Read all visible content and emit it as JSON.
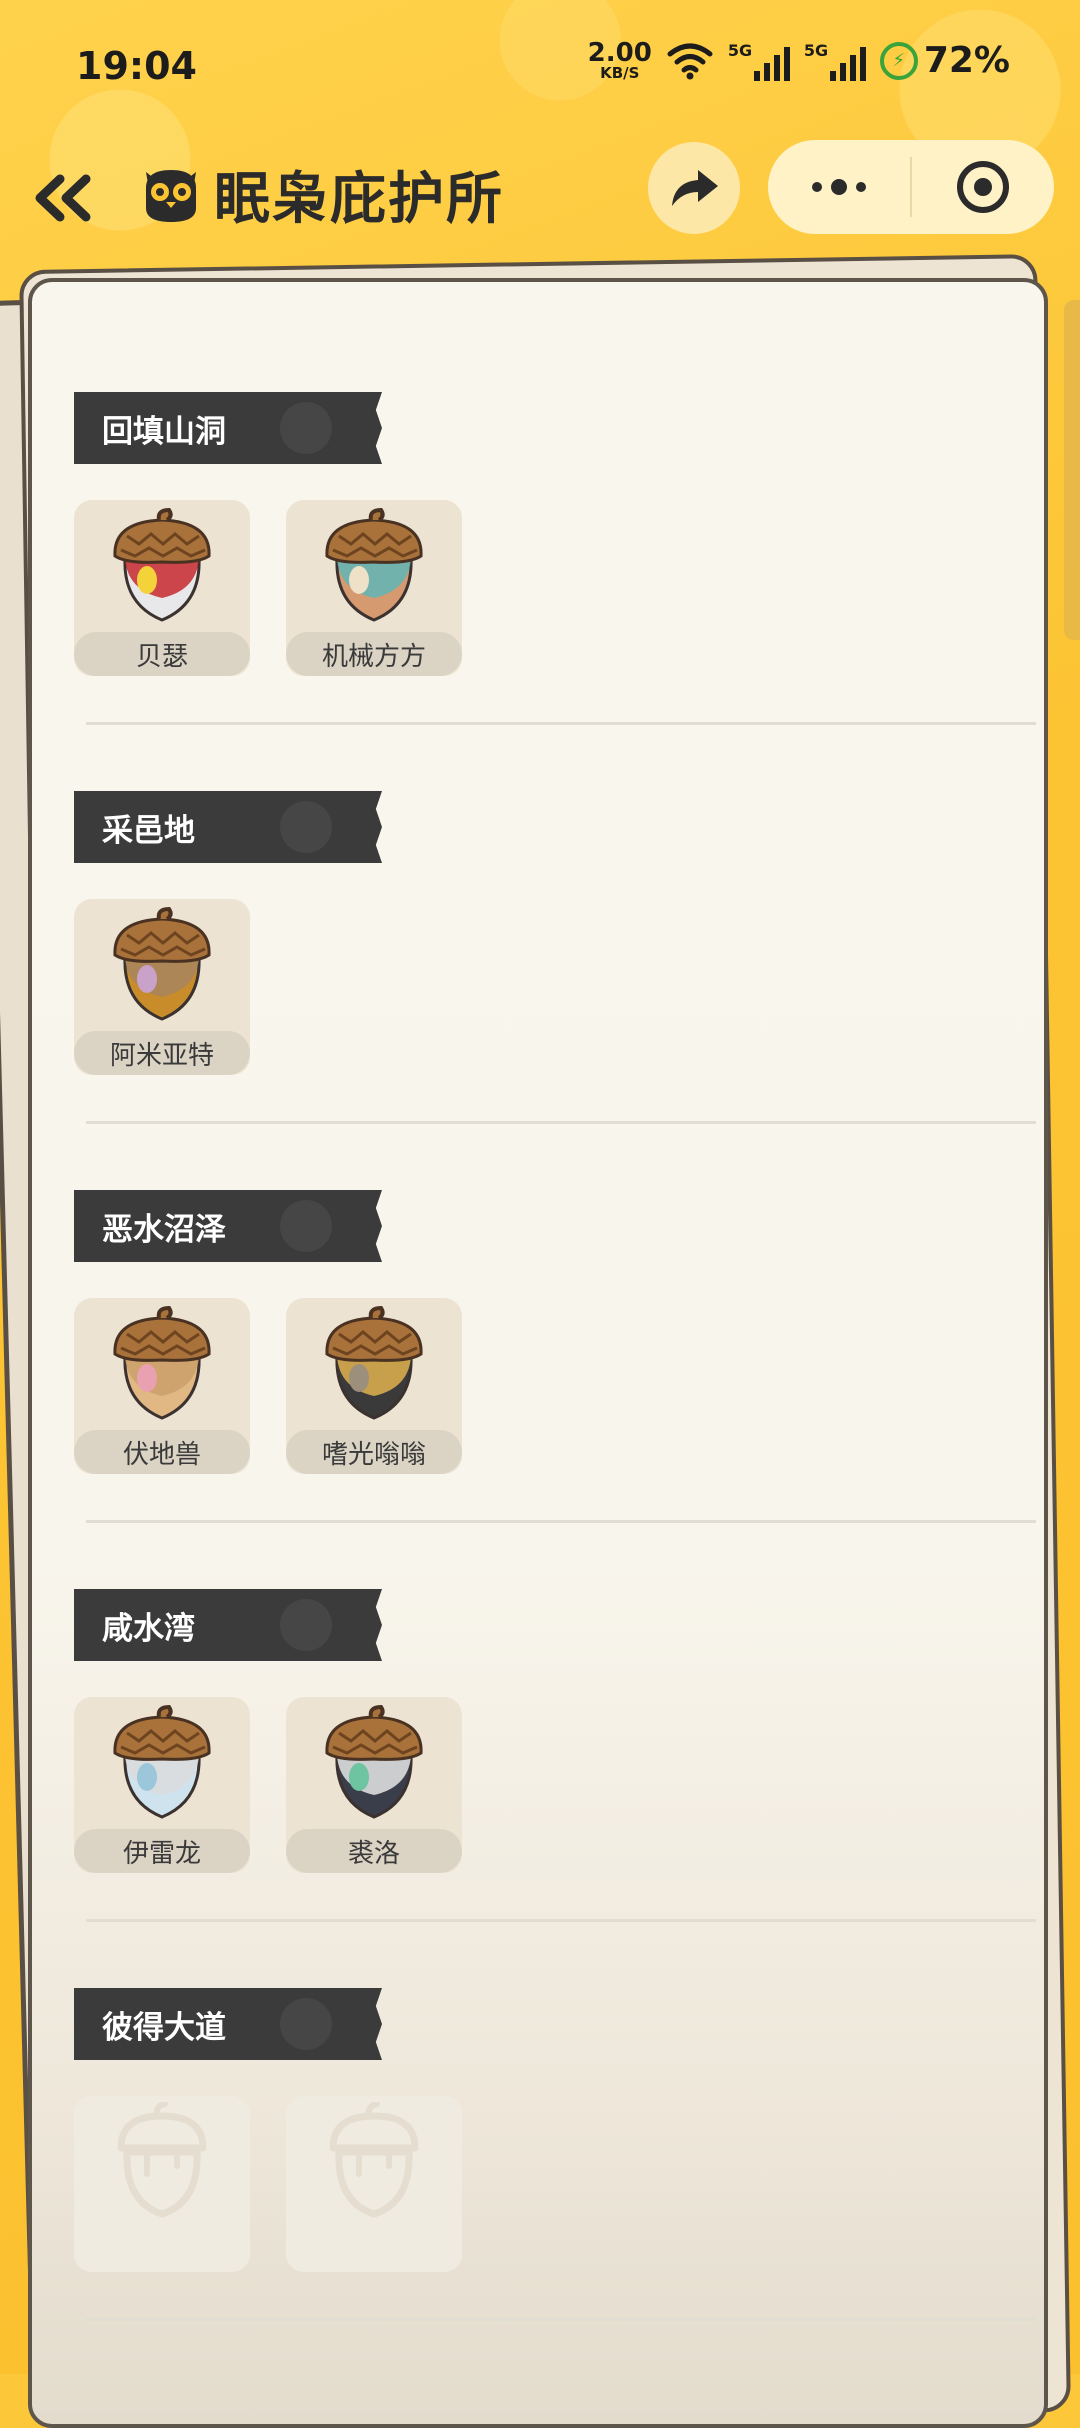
{
  "status": {
    "time": "19:04",
    "net_speed_value": "2.00",
    "net_speed_unit": "KB/S",
    "signal1_tag": "5G",
    "signal2_tag": "5G",
    "battery_percent": "72%"
  },
  "nav": {
    "title": "眠枭庇护所"
  },
  "sections": [
    {
      "name": "回填山洞",
      "items": [
        {
          "label": "贝瑟",
          "colors": [
            "#e8e8ea",
            "#c5282e",
            "#f3d23a"
          ]
        },
        {
          "label": "机械方方",
          "colors": [
            "#d59a6f",
            "#5fb6b8",
            "#efe0c8"
          ]
        }
      ]
    },
    {
      "name": "采邑地",
      "items": [
        {
          "label": "阿米亚特",
          "colors": [
            "#c98c2b",
            "#a7855f",
            "#c9a2c9"
          ]
        }
      ]
    },
    {
      "name": "恶水沼泽",
      "items": [
        {
          "label": "伏地兽",
          "colors": [
            "#e1b784",
            "#caa06a",
            "#e9a0b0"
          ]
        },
        {
          "label": "嗜光嗡嗡",
          "colors": [
            "#3a3a3a",
            "#e2b34f",
            "#9c8f7b"
          ]
        }
      ]
    },
    {
      "name": "咸水湾",
      "items": [
        {
          "label": "伊雷龙",
          "colors": [
            "#cfe3ee",
            "#dcdcdc",
            "#9cc6da"
          ]
        },
        {
          "label": "裘洛",
          "colors": [
            "#3a3e4a",
            "#e6e6e6",
            "#6ec4a0"
          ]
        }
      ]
    },
    {
      "name": "彼得大道",
      "items": [
        {
          "label": "",
          "locked": true
        },
        {
          "label": "",
          "locked": true
        }
      ]
    }
  ]
}
